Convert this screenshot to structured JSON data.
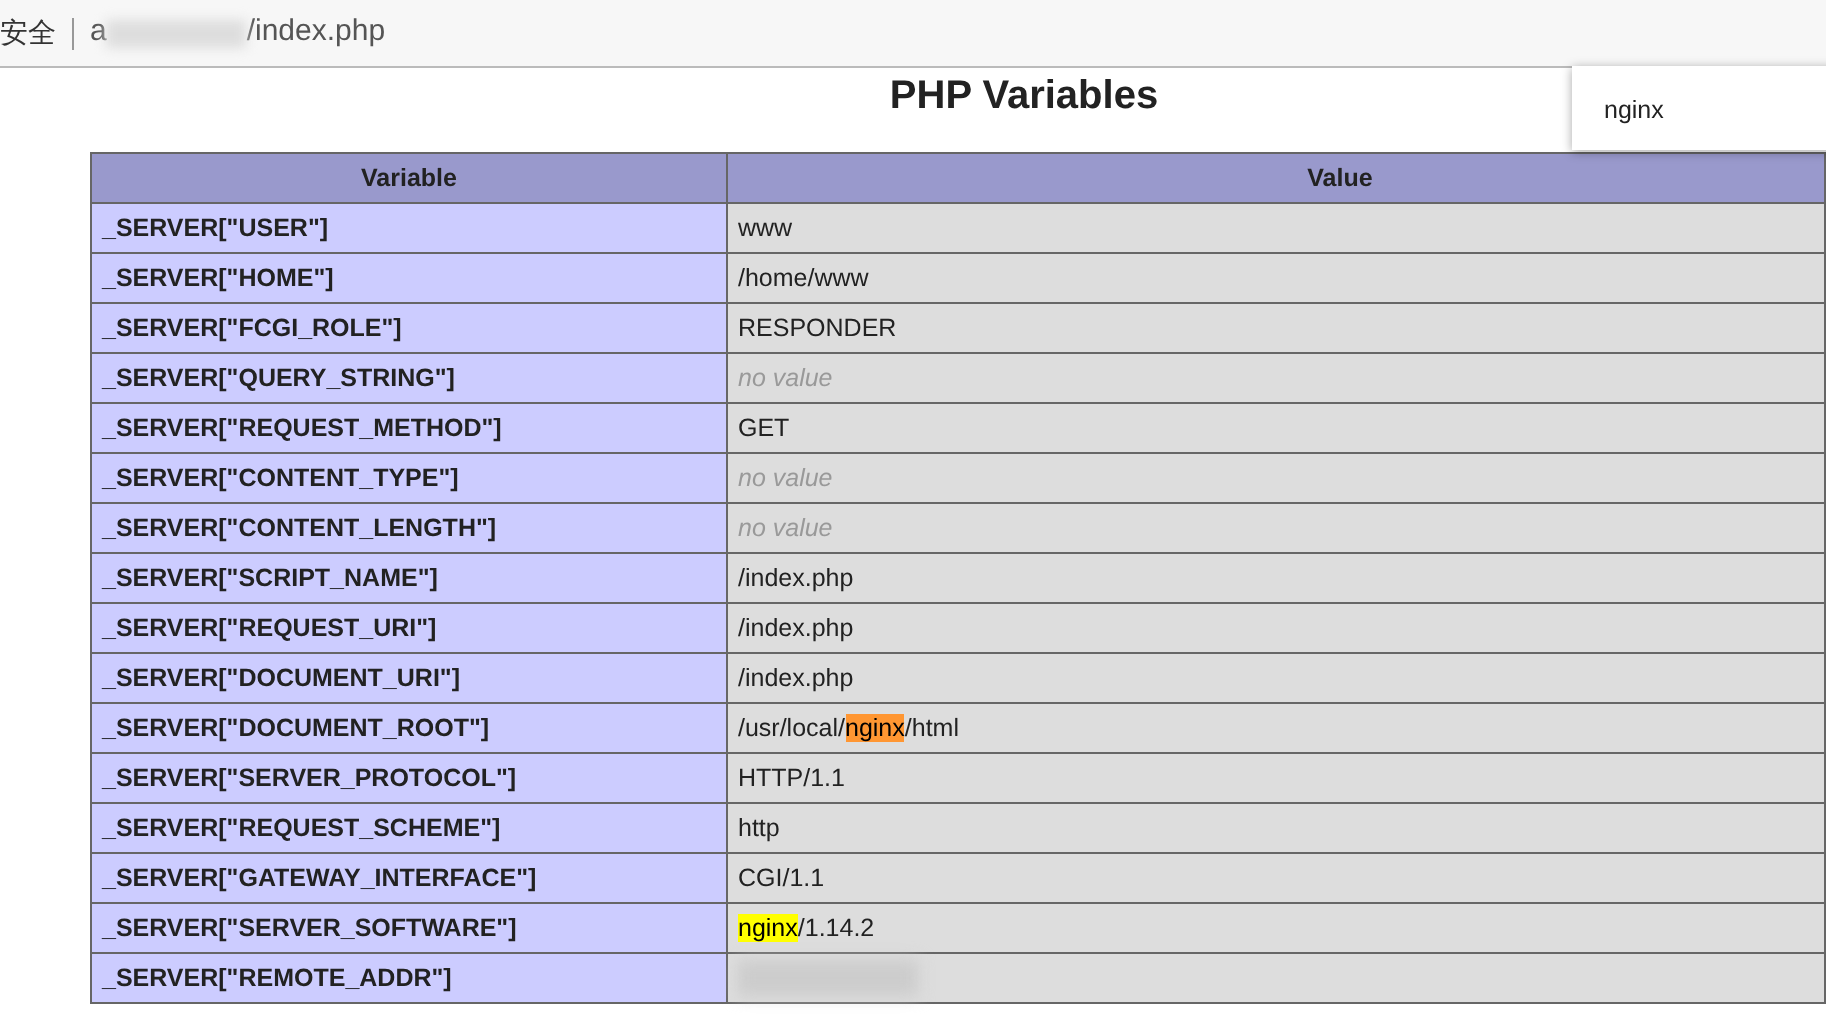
{
  "address_bar": {
    "security_label": "安全",
    "url_start": "a",
    "url_end": "/index.php"
  },
  "find_bar": {
    "query": "nginx"
  },
  "page_title": "PHP Variables",
  "table": {
    "columns": [
      "Variable",
      "Value"
    ],
    "rows": [
      {
        "variable": "_SERVER[\"USER\"]",
        "value": "www"
      },
      {
        "variable": "_SERVER[\"HOME\"]",
        "value": "/home/www"
      },
      {
        "variable": "_SERVER[\"FCGI_ROLE\"]",
        "value": "RESPONDER"
      },
      {
        "variable": "_SERVER[\"QUERY_STRING\"]",
        "no_value": true,
        "value": "no value"
      },
      {
        "variable": "_SERVER[\"REQUEST_METHOD\"]",
        "value": "GET"
      },
      {
        "variable": "_SERVER[\"CONTENT_TYPE\"]",
        "no_value": true,
        "value": "no value"
      },
      {
        "variable": "_SERVER[\"CONTENT_LENGTH\"]",
        "no_value": true,
        "value": "no value"
      },
      {
        "variable": "_SERVER[\"SCRIPT_NAME\"]",
        "value": "/index.php"
      },
      {
        "variable": "_SERVER[\"REQUEST_URI\"]",
        "value": "/index.php"
      },
      {
        "variable": "_SERVER[\"DOCUMENT_URI\"]",
        "value": "/index.php"
      },
      {
        "variable": "_SERVER[\"DOCUMENT_ROOT\"]",
        "value_parts": [
          {
            "text": "/usr/local/",
            "highlighted": false,
            "current": false
          },
          {
            "text": "nginx",
            "highlighted": true,
            "current": true
          },
          {
            "text": "/html",
            "highlighted": false,
            "current": false
          }
        ]
      },
      {
        "variable": "_SERVER[\"SERVER_PROTOCOL\"]",
        "value": "HTTP/1.1"
      },
      {
        "variable": "_SERVER[\"REQUEST_SCHEME\"]",
        "value": "http"
      },
      {
        "variable": "_SERVER[\"GATEWAY_INTERFACE\"]",
        "value": "CGI/1.1"
      },
      {
        "variable": "_SERVER[\"SERVER_SOFTWARE\"]",
        "value_parts": [
          {
            "text": "nginx",
            "highlighted": true,
            "current": false
          },
          {
            "text": "/1.14.2",
            "highlighted": false,
            "current": false
          }
        ]
      },
      {
        "variable": "_SERVER[\"REMOTE_ADDR\"]",
        "blurred": true
      }
    ]
  }
}
